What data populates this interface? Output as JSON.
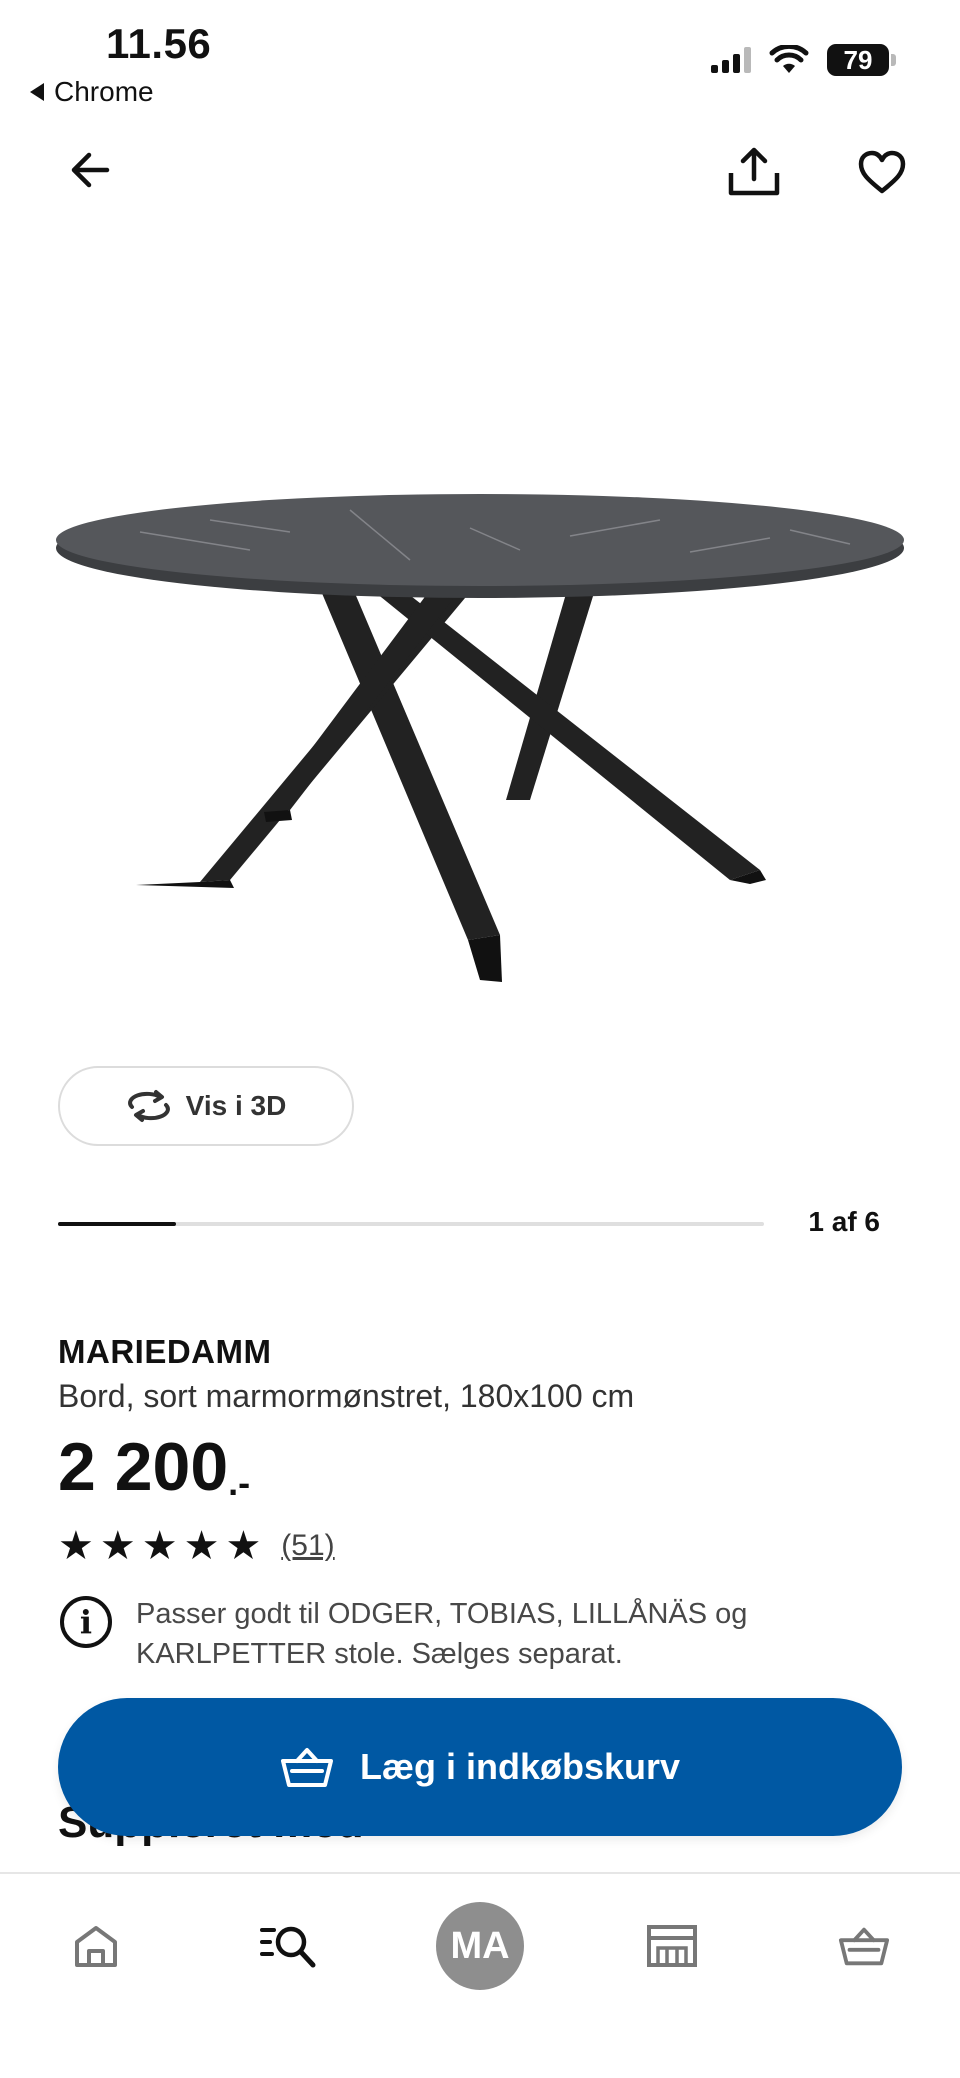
{
  "status_bar": {
    "time": "11.56",
    "back_app": "Chrome",
    "battery": "79"
  },
  "header": {
    "back_icon": "arrow-left-icon",
    "share_icon": "share-icon",
    "favorite_icon": "heart-icon"
  },
  "gallery": {
    "view_3d_label": "Vis i 3D",
    "counter": "1 af 6",
    "progress_fraction": 0.167
  },
  "product": {
    "name": "MARIEDAMM",
    "description": "Bord, sort marmormønstret, 180x100 cm",
    "price": "2 200",
    "price_suffix": ".-",
    "rating_stars": 5,
    "review_count": "(51)",
    "info_text": "Passer godt til ODGER, TOBIAS, LILLÅNÄS og KARLPETTER stole. Sælges separat."
  },
  "section": {
    "heading": "Suppleret med"
  },
  "cart": {
    "label": "Læg i indkøbskurv",
    "color": "#0058a3"
  },
  "bottom_nav": {
    "avatar_initials": "MA",
    "items": [
      "home-icon",
      "search-icon",
      "avatar",
      "store-icon",
      "basket-icon"
    ]
  }
}
